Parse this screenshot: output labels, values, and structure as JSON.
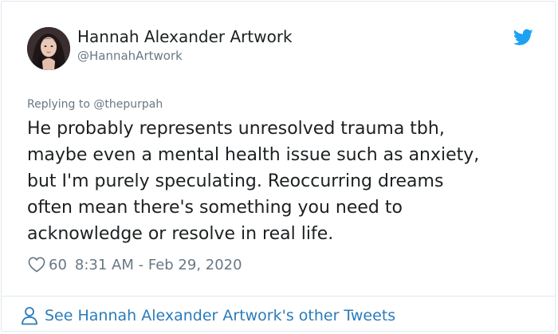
{
  "author": {
    "display_name": "Hannah Alexander Artwork",
    "handle": "@HannahArtwork"
  },
  "icons": {
    "platform": "twitter-bird-icon",
    "like": "heart-outline-icon",
    "profile": "person-outline-icon"
  },
  "reply": {
    "prefix": "Replying to ",
    "mention": "@thepurpah"
  },
  "tweet": {
    "lines": [
      "He probably represents unresolved trauma tbh,",
      "maybe even a mental health issue such as anxiety,",
      "but I'm purely speculating. Reoccurring dreams",
      "often mean there's something you need to",
      "acknowledge or resolve in real life."
    ]
  },
  "meta": {
    "like_count": "60",
    "timestamp": "8:31 AM - Feb 29, 2020"
  },
  "footer": {
    "link_text": "See Hannah Alexander Artwork's other Tweets"
  },
  "colors": {
    "twitter_blue": "#1da1f2",
    "link_blue": "#2b7bb9",
    "secondary_text": "#697882",
    "primary_text": "#1c2022",
    "border": "#e1e8ed"
  }
}
